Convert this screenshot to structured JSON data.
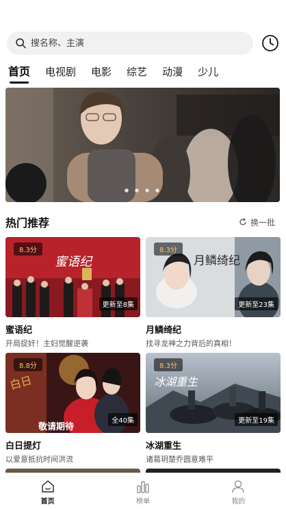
{
  "search": {
    "placeholder": "搜名称、主演"
  },
  "tabs": [
    {
      "label": "首页",
      "active": true
    },
    {
      "label": "电视剧"
    },
    {
      "label": "电影"
    },
    {
      "label": "综艺"
    },
    {
      "label": "动漫"
    },
    {
      "label": "少儿"
    }
  ],
  "banner": {
    "slide_count": 4,
    "active_slide": 1
  },
  "section": {
    "title": "热门推荐",
    "refresh_label": "换一批"
  },
  "cards": [
    {
      "title": "蜜语纪",
      "subtitle": "开局捉奸！主妇觉醒逆袭",
      "rating": "8.3分",
      "badge": "更新至8集",
      "poster_title": "蜜语纪"
    },
    {
      "title": "月鳞绮纪",
      "subtitle": "找寻龙神之力背后的真相！",
      "rating": "8.3分",
      "badge": "更新至23集",
      "poster_title": "月鳞绮纪"
    },
    {
      "title": "白日提灯",
      "subtitle": "以爱意抵抗时间洪流",
      "rating": "8.8分",
      "badge": "全40集",
      "poster_title": "敬请期待"
    },
    {
      "title": "冰湖重生",
      "subtitle": "诸葛玥楚乔圆意难平",
      "rating": "8.3分",
      "badge": "更新至19集",
      "poster_title": "冰湖重生"
    }
  ],
  "bottom_nav": [
    {
      "label": "首页",
      "icon": "home-icon",
      "active": true
    },
    {
      "label": "榜单",
      "icon": "ranking-icon"
    },
    {
      "label": "我的",
      "icon": "profile-icon"
    }
  ],
  "colors": {
    "accent": "#111111",
    "rating_text": "#f4c76b"
  }
}
